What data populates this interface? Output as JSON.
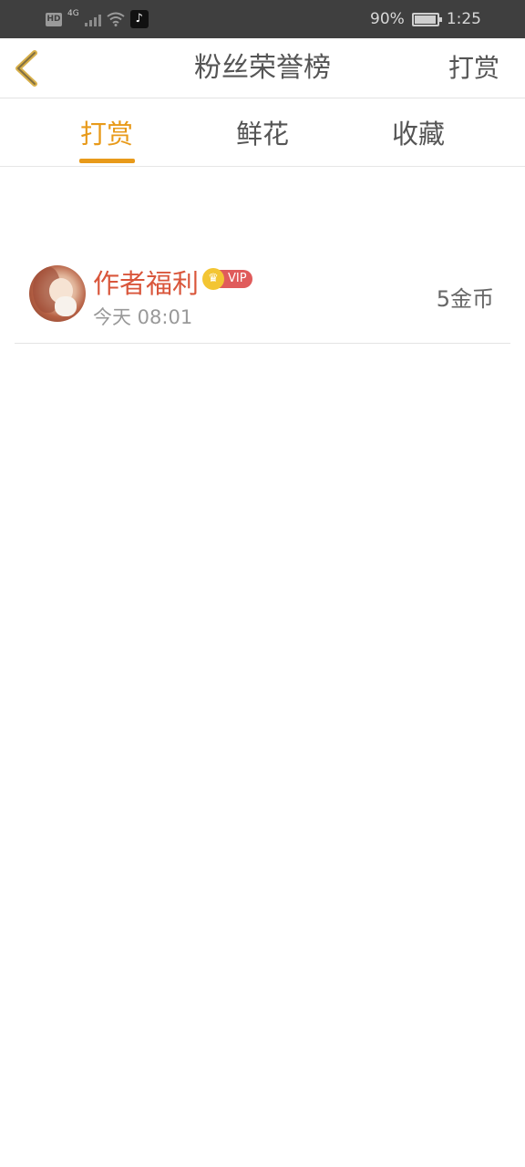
{
  "status_bar": {
    "hd": "HD",
    "network": "4G",
    "app_icon": "tiktok-icon",
    "battery_percent": "90%",
    "battery_level": 0.9,
    "time": "1:25"
  },
  "header": {
    "back_icon": "chevron-left-icon",
    "title": "粉丝荣誉榜",
    "action": "打赏"
  },
  "tabs": [
    {
      "label": "打赏",
      "active": true
    },
    {
      "label": "鲜花",
      "active": false
    },
    {
      "label": "收藏",
      "active": false
    }
  ],
  "list": [
    {
      "name": "作者福利",
      "badge": "VIP",
      "time": "今天 08:01",
      "amount": "5金币"
    }
  ],
  "colors": {
    "accent": "#e89a1a",
    "username": "#d9563b",
    "vip": "#e05b5b",
    "crown": "#f3c533"
  }
}
